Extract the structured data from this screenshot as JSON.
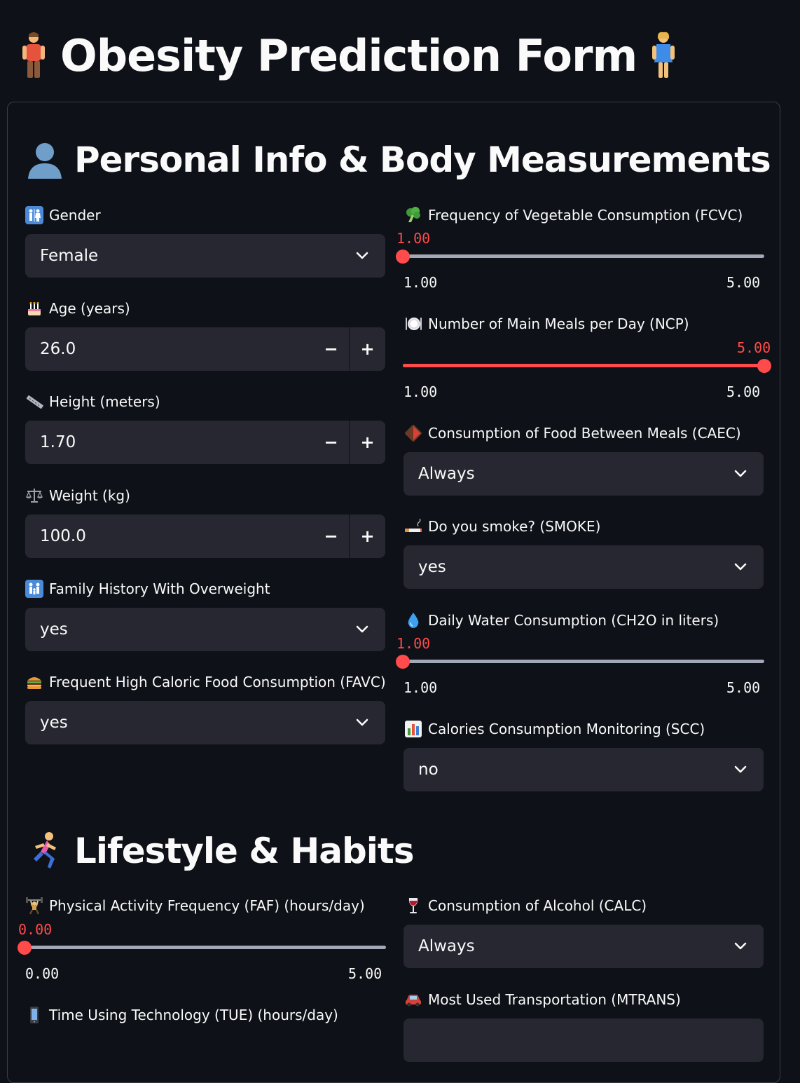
{
  "page": {
    "title": "Obesity Prediction Form",
    "title_icon_left": "man-standing-icon",
    "title_icon_right": "woman-standing-icon"
  },
  "sections": {
    "personal": {
      "title": "Personal Info & Body Measurements",
      "icon": "bust-silhouette-icon"
    },
    "lifestyle": {
      "title": "Lifestyle & Habits",
      "icon": "runner-icon"
    }
  },
  "fields": {
    "gender": {
      "label": "Gender",
      "icon": "restroom-icon",
      "value": "Female"
    },
    "age": {
      "label": "Age (years)",
      "icon": "birthday-cake-icon",
      "value": "26.0"
    },
    "height": {
      "label": "Height (meters)",
      "icon": "ruler-icon",
      "value": "1.70"
    },
    "weight": {
      "label": "Weight (kg)",
      "icon": "balance-scale-icon",
      "value": "100.0"
    },
    "family_history": {
      "label": "Family History With Overweight",
      "icon": "family-icon",
      "value": "yes"
    },
    "favc": {
      "label": "Frequent High Caloric Food Consumption (FAVC)",
      "icon": "burger-icon",
      "value": "yes"
    },
    "fcvc": {
      "label": "Frequency of Vegetable Consumption (FCVC)",
      "icon": "broccoli-icon",
      "value": "1.00",
      "min": "1.00",
      "max": "5.00",
      "fraction": 0
    },
    "ncp": {
      "label": "Number of Main Meals per Day (NCP)",
      "icon": "plate-icon",
      "value": "5.00",
      "min": "1.00",
      "max": "5.00",
      "fraction": 1
    },
    "caec": {
      "label": "Consumption of Food Between Meals (CAEC)",
      "icon": "chocolate-icon",
      "value": "Always"
    },
    "smoke": {
      "label": "Do you smoke? (SMOKE)",
      "icon": "cigarette-icon",
      "value": "yes"
    },
    "ch2o": {
      "label": "Daily Water Consumption (CH2O in liters)",
      "icon": "droplet-icon",
      "value": "1.00",
      "min": "1.00",
      "max": "5.00",
      "fraction": 0
    },
    "scc": {
      "label": "Calories Consumption Monitoring (SCC)",
      "icon": "bar-chart-icon",
      "value": "no"
    },
    "faf": {
      "label": "Physical Activity Frequency (FAF) (hours/day)",
      "icon": "weightlifter-icon",
      "value": "0.00",
      "min": "0.00",
      "max": "5.00",
      "fraction": 0
    },
    "tue": {
      "label": "Time Using Technology (TUE) (hours/day)",
      "icon": "mobile-phone-icon"
    },
    "calc": {
      "label": "Consumption of Alcohol (CALC)",
      "icon": "wine-glass-icon",
      "value": "Always"
    },
    "mtrans": {
      "label": "Most Used Transportation (MTRANS)",
      "icon": "car-icon"
    }
  },
  "stepper": {
    "minus": "−",
    "plus": "+"
  },
  "colors": {
    "background": "#0e1117",
    "input_bg": "#262730",
    "accent": "#ff4b4b",
    "track": "#a3a8b8",
    "border": "#3b3e46"
  }
}
